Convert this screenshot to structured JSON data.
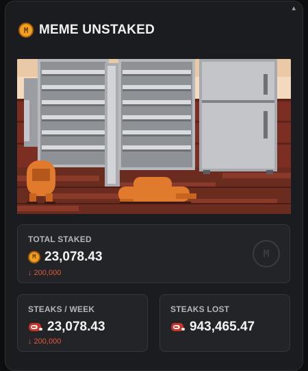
{
  "header": {
    "title": "MEME UNSTAKED",
    "coin_letter": "M"
  },
  "total_staked": {
    "label": "TOTAL STAKED",
    "value": "23,078.43",
    "delta": "↓ 200,000"
  },
  "steaks_week": {
    "label": "STEAKS / WEEK",
    "value": "23,078.43",
    "delta": "↓ 200,000"
  },
  "steaks_lost": {
    "label": "STEAKS LOST",
    "value": "943,465.47"
  },
  "icons": {
    "coin": "meme-coin-icon",
    "steak": "steak-icon",
    "watermark": "meme-logo-watermark"
  },
  "colors": {
    "accent": "#f0a21d",
    "negative": "#e05a3a",
    "card_bg": "#232428",
    "panel_bg": "#1b1c1f"
  }
}
